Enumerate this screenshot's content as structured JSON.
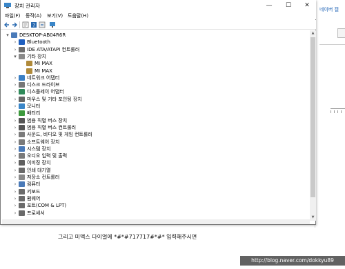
{
  "window": {
    "title": "장치 관리자",
    "controls": {
      "minimize": "—",
      "maximize": "☐",
      "close": "✕"
    }
  },
  "menu": [
    "파일(F)",
    "동작(A)",
    "보기(V)",
    "도움말(H)"
  ],
  "toolbar_icons": [
    "back-arrow-icon",
    "forward-arrow-icon",
    "properties-icon",
    "help-icon",
    "scan-icon",
    "monitor-icon"
  ],
  "tree": [
    {
      "label": "DESKTOP-AB04R6R",
      "level": 0,
      "expander": "▾",
      "icon": "computer-icon",
      "color": "#4a7ab8"
    },
    {
      "label": "Bluetooth",
      "level": 1,
      "expander": "›",
      "icon": "bluetooth-icon",
      "color": "#1f5fbf"
    },
    {
      "label": "IDE ATA/ATAPI 컨트롤러",
      "level": 1,
      "expander": "›",
      "icon": "ide-controller-icon",
      "color": "#6d6d6d"
    },
    {
      "label": "기타 장치",
      "level": 1,
      "expander": "▾",
      "icon": "other-devices-icon",
      "color": "#8a8a8a"
    },
    {
      "label": "MI MAX",
      "level": 2,
      "expander": "",
      "icon": "unknown-device-warning-icon",
      "color": "#b08a3a"
    },
    {
      "label": "MI MAX",
      "level": 2,
      "expander": "",
      "icon": "unknown-device-warning-icon",
      "color": "#b08a3a"
    },
    {
      "label": "네트워크 어댑터",
      "level": 1,
      "expander": "›",
      "icon": "network-adapter-icon",
      "color": "#3a7fc4"
    },
    {
      "label": "디스크 드라이브",
      "level": 1,
      "expander": "›",
      "icon": "disk-drive-icon",
      "color": "#777777"
    },
    {
      "label": "디스플레이 어댑터",
      "level": 1,
      "expander": "›",
      "icon": "display-adapter-icon",
      "color": "#2f8a5a"
    },
    {
      "label": "마우스 및 기타 포인팅 장치",
      "level": 1,
      "expander": "›",
      "icon": "mouse-icon",
      "color": "#666666"
    },
    {
      "label": "모니터",
      "level": 1,
      "expander": "›",
      "icon": "monitor-icon",
      "color": "#3a86c8"
    },
    {
      "label": "배터리",
      "level": 1,
      "expander": "›",
      "icon": "battery-icon",
      "color": "#3d9a3d"
    },
    {
      "label": "범용 직렬 버스 장치",
      "level": 1,
      "expander": "›",
      "icon": "usb-device-icon",
      "color": "#555555"
    },
    {
      "label": "범용 직렬 버스 컨트롤러",
      "level": 1,
      "expander": "›",
      "icon": "usb-controller-icon",
      "color": "#555555"
    },
    {
      "label": "사운드, 비디오 및 게임 컨트롤러",
      "level": 1,
      "expander": "›",
      "icon": "sound-icon",
      "color": "#7a7a7a"
    },
    {
      "label": "소프트웨어 장치",
      "level": 1,
      "expander": "›",
      "icon": "software-device-icon",
      "color": "#7a7a7a"
    },
    {
      "label": "시스템 장치",
      "level": 1,
      "expander": "›",
      "icon": "system-device-icon",
      "color": "#4a7ab8"
    },
    {
      "label": "오디오 입력 및 출력",
      "level": 1,
      "expander": "›",
      "icon": "audio-io-icon",
      "color": "#7a7a7a"
    },
    {
      "label": "이미징 장치",
      "level": 1,
      "expander": "›",
      "icon": "imaging-device-icon",
      "color": "#5f5f5f"
    },
    {
      "label": "인쇄 대기열",
      "level": 1,
      "expander": "›",
      "icon": "print-queue-icon",
      "color": "#6a6a6a"
    },
    {
      "label": "저장소 컨트롤러",
      "level": 1,
      "expander": "›",
      "icon": "storage-controller-icon",
      "color": "#8a8a8a"
    },
    {
      "label": "컴퓨터",
      "level": 1,
      "expander": "›",
      "icon": "computer-icon",
      "color": "#4a7ab8"
    },
    {
      "label": "키보드",
      "level": 1,
      "expander": "›",
      "icon": "keyboard-icon",
      "color": "#6a6a6a"
    },
    {
      "label": "펌웨어",
      "level": 1,
      "expander": "›",
      "icon": "firmware-icon",
      "color": "#6a6a6a"
    },
    {
      "label": "포트(COM & LPT)",
      "level": 1,
      "expander": "›",
      "icon": "port-icon",
      "color": "#6a6a6a"
    },
    {
      "label": "프로세서",
      "level": 1,
      "expander": "›",
      "icon": "processor-icon",
      "color": "#6a6a6a"
    }
  ],
  "background_app": {
    "link_text": "네이버 캘",
    "accent": "#1a5fb4"
  },
  "caption": "그리고 미맥스 다이얼에 *#*#717717#*#* 입력해주시면",
  "watermark": "http://blog.naver.com/dokkyu89"
}
